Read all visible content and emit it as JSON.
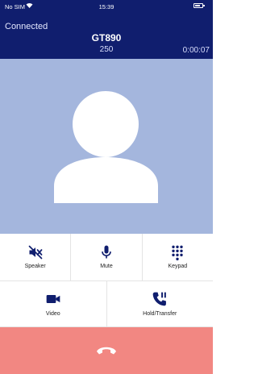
{
  "status_bar": {
    "carrier": "No SIM",
    "time": "15:39",
    "wifi_icon": "wifi-icon",
    "battery_icon": "battery-icon"
  },
  "call": {
    "state": "Connected",
    "contact_name": "GT890",
    "number": "250",
    "duration": "0:00:07"
  },
  "avatar": {
    "icon": "person-silhouette-icon",
    "background": "#a4b6dd"
  },
  "controls": {
    "speaker": {
      "label": "Speaker",
      "icon": "speaker-muted-icon"
    },
    "mute": {
      "label": "Mute",
      "icon": "microphone-icon"
    },
    "keypad": {
      "label": "Keypad",
      "icon": "dialpad-icon"
    },
    "video": {
      "label": "Video",
      "icon": "video-camera-icon"
    },
    "hold_transfer": {
      "label": "Hold/Transfer",
      "icon": "phone-pause-icon"
    }
  },
  "end_call": {
    "icon": "hang-up-icon",
    "background": "#f28782"
  },
  "colors": {
    "header": "#101e6e",
    "icon": "#101e6e",
    "accent_end": "#f28782"
  }
}
